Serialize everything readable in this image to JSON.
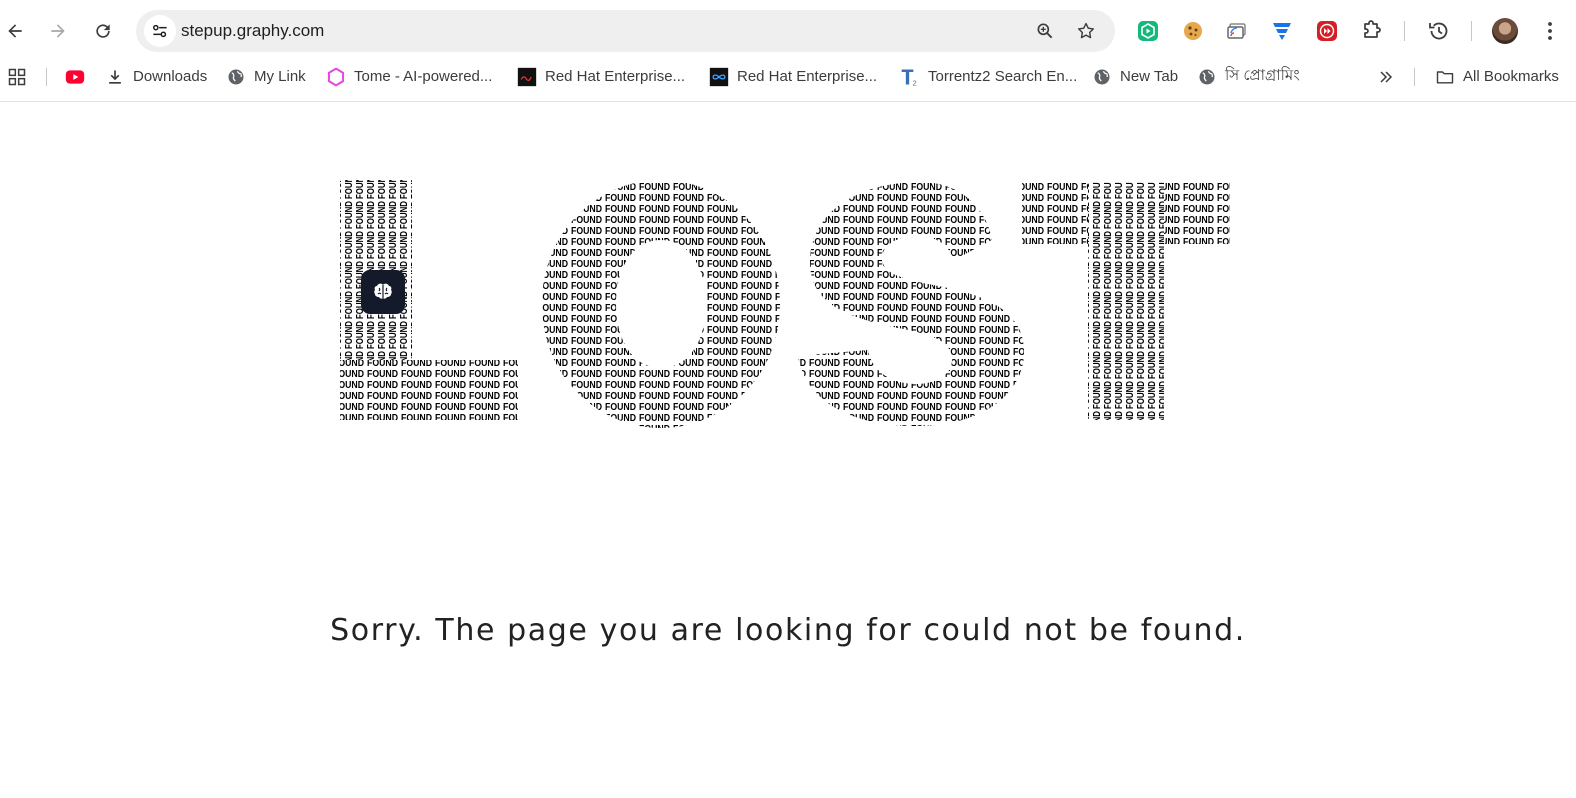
{
  "browser": {
    "url": "stepup.graphy.com",
    "omnibox_icons": [
      "zoom-icon",
      "bookmark-star-icon"
    ],
    "extensions": [
      "green-play-extension-icon",
      "cookie-extension-icon",
      "cast-extension-icon",
      "blue-logo-extension-icon",
      "red-forward-extension-icon",
      "puzzle-extensions-icon"
    ],
    "history_icon": "history-icon",
    "menu_icon": "kebab-menu-icon"
  },
  "bookmarks": {
    "items": [
      {
        "label": "",
        "icon": "youtube-icon"
      },
      {
        "label": "Downloads",
        "icon": "download-icon"
      },
      {
        "label": "My Link",
        "icon": "globe-icon"
      },
      {
        "label": "Tome - AI-powered...",
        "icon": "tome-icon"
      },
      {
        "label": "Red Hat Enterprise...",
        "icon": "redhat-icon"
      },
      {
        "label": "Red Hat Enterprise...",
        "icon": "infinity-icon"
      },
      {
        "label": "Torrentz2 Search En...",
        "icon": "torrentz-icon"
      },
      {
        "label": "New Tab",
        "icon": "globe-icon"
      },
      {
        "label": "সি প্রোগ্রামিং",
        "icon": "globe-icon"
      }
    ],
    "overflow_icon": "chevron-double-right-icon",
    "all_bookmarks": "All Bookmarks"
  },
  "page": {
    "art_word": "LOST",
    "art_fill_word": "FOUND",
    "message": "Sorry. The page you are looking for could not be found."
  },
  "colors": {
    "badge_bg": "#151a2b",
    "omnibox_bg": "#efefef"
  }
}
